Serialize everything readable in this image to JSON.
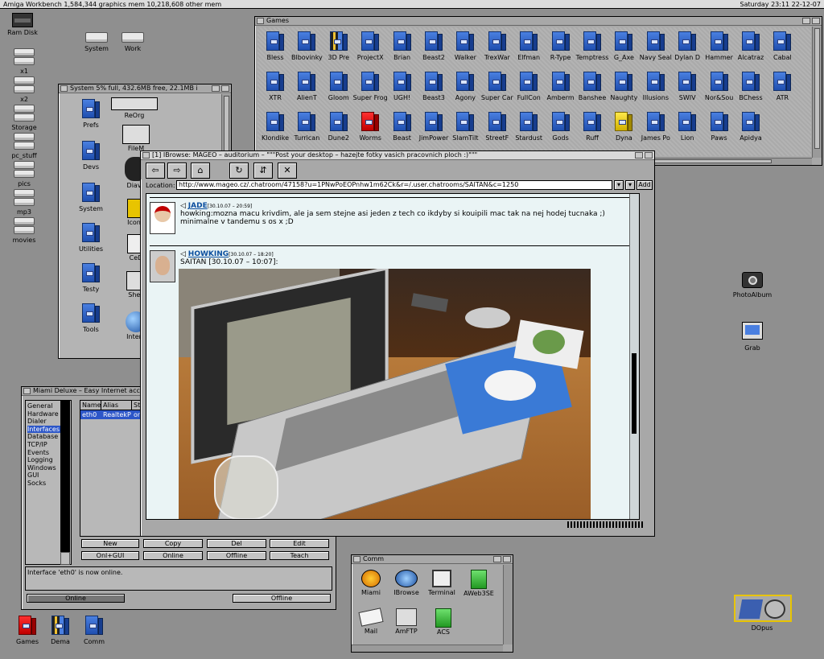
{
  "screen": {
    "left": "Amiga Workbench  1,584,344 graphics mem  10,218,608 other mem",
    "right": "Saturday   23:11   22-12-07"
  },
  "desktop": {
    "left_icons": [
      "Ram Disk",
      "x1",
      "x2",
      "Storage",
      "pc_stuff",
      "pics",
      "mp3",
      "movies"
    ],
    "top_icons": [
      "System",
      "Work"
    ],
    "right_icons": [
      "PhotoAlbum",
      "Grab"
    ],
    "bottom_icons": [
      "Games",
      "Dema",
      "Comm"
    ],
    "dopus": "DOpus"
  },
  "games_window": {
    "title": "Games",
    "rows": [
      [
        "Bless",
        "Blbovinky",
        "3D Pre",
        "ProjectX",
        "Brian",
        "Beast2",
        "Walker",
        "TrexWar",
        "Elfman",
        "R-Type",
        "Temptress",
        "G_Axe",
        "Navy Seal",
        "Dylan D",
        "Hammer",
        "Alcatraz",
        "Cabal"
      ],
      [
        "XTR",
        "AlienT",
        "Gloom",
        "Super Frog",
        "UGH!",
        "Beast3",
        "Agony",
        "Super Car",
        "FullCon",
        "Amberm",
        "Banshee",
        "Naughty",
        "Illusions",
        "SWIV",
        "Nor&Sou",
        "BChess",
        "ATR"
      ],
      [
        "Klondike",
        "Turrican",
        "Dune2",
        "Worms",
        "Beast",
        "JimPower",
        "SlamTilt",
        "StreetF",
        "Stardust",
        "Gods",
        "Ruff",
        "Dyna",
        "James Po",
        "Lion",
        "Paws",
        "Apidya"
      ]
    ]
  },
  "system_window": {
    "title": "System  5% full, 432.6MB free, 22.1MB i",
    "items": [
      "Prefs",
      "Devs",
      "System",
      "Utilities",
      "Testy",
      "Tools"
    ],
    "items2": [
      "ReOrg",
      "FileM",
      "Diavo",
      "IconE",
      "CeD",
      "Shell",
      "Intern"
    ]
  },
  "miami": {
    "title": "Miami Deluxe – Easy Internet acce",
    "menu": [
      "General",
      "Hardware",
      "Dialer",
      "Interfaces",
      "Database",
      "TCP/IP",
      "Events",
      "Logging",
      "Windows",
      "GUI",
      "Socks"
    ],
    "columns": [
      "Name",
      "Alias",
      "St"
    ],
    "row": [
      "eth0",
      "RealtekP",
      "on"
    ],
    "buttons": [
      "New",
      "Copy",
      "Del",
      "Edit",
      "Onl+GUI",
      "Online",
      "Offline",
      "Teach"
    ],
    "status": "Interface 'eth0' is now online.",
    "online": "Online",
    "offline": "Offline"
  },
  "browser": {
    "title": "[1] IBrowse: MAGEO – auditorium – \"\"\"Post your desktop – hazejte fotky vasich pracovnich ploch :)\"\"\"",
    "location_label": "Location:",
    "url": "http://www.mageo.cz/.chatroom/47158?u=1PNwPoEOPnhw1m62Ck&r=/.user.chatrooms/SAITAN&c=1250",
    "add": "Add",
    "post1": {
      "user": "JADE",
      "time": "[30.10.07 – 20:59]",
      "text": "howking:mozna macu krivdim, ale ja sem stejne asi jeden z tech co ikdyby si kouipili mac tak na nej hodej tucnaka ;) minimalne v tandemu s os x ;D"
    },
    "post2": {
      "user": "HOWKING",
      "time": "[30.10.07 – 18:20]",
      "text": "SAITAN [30.10.07 –  10:07]:"
    }
  },
  "comm": {
    "title": "Comm",
    "items": [
      "Miami",
      "IBrowse",
      "Terminal",
      "AWeb3SE",
      "Mail",
      "AmFTP",
      "ACS"
    ]
  }
}
